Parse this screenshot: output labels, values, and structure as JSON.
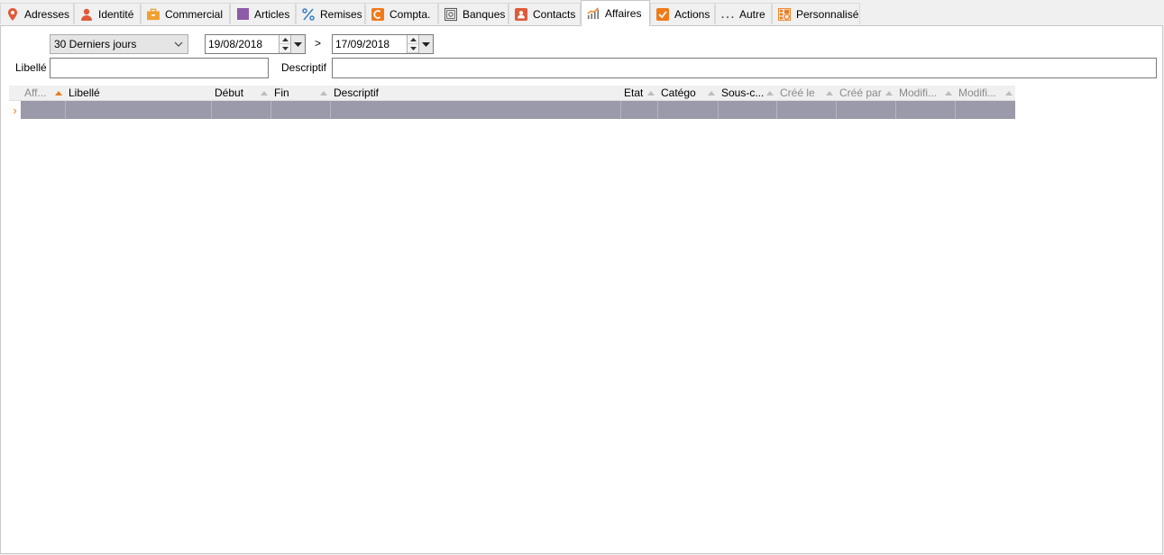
{
  "tabs": [
    {
      "label": "Adresses",
      "icon": "map-pin-icon",
      "color": "#e05a3a"
    },
    {
      "label": "Identité",
      "icon": "person-icon",
      "color": "#e05a3a"
    },
    {
      "label": "Commercial",
      "icon": "briefcase-icon",
      "color": "#f0a030"
    },
    {
      "label": "Articles",
      "icon": "square-icon",
      "color": "#8e5ba8"
    },
    {
      "label": "Remises",
      "icon": "percent-icon",
      "color": "#3a7fc4"
    },
    {
      "label": "Compta.",
      "icon": "accounting-icon",
      "color": "#f07a1a"
    },
    {
      "label": "Banques",
      "icon": "safe-icon",
      "color": "#555555"
    },
    {
      "label": "Contacts",
      "icon": "contact-card-icon",
      "color": "#e05a3a"
    },
    {
      "label": "Affaires",
      "icon": "chart-icon",
      "color": "#f07a1a",
      "active": true
    },
    {
      "label": "Actions",
      "icon": "checkbox-icon",
      "color": "#f07a1a"
    },
    {
      "label": "Autre",
      "icon": "more-dots-icon",
      "color": "#555555"
    },
    {
      "label": "Personnalisé",
      "icon": "custom-icon",
      "color": "#f07a1a"
    }
  ],
  "filter": {
    "period": "30 Derniers jours",
    "date_from": "19/08/2018",
    "date_sep": ">",
    "date_to": "17/09/2018",
    "libelle_label": "Libellé",
    "libelle_value": "",
    "descriptif_label": "Descriptif",
    "descriptif_value": ""
  },
  "grid": {
    "columns": [
      {
        "label": "Aff...",
        "dim": true,
        "sort": "asc-active"
      },
      {
        "label": "Libellé"
      },
      {
        "label": "Début",
        "sort": "asc"
      },
      {
        "label": "Fin",
        "sort": "asc"
      },
      {
        "label": "Descriptif"
      },
      {
        "label": "Etat",
        "sort": "asc"
      },
      {
        "label": "Catégo",
        "sort": "asc"
      },
      {
        "label": "Sous-c...",
        "sort": "asc"
      },
      {
        "label": "Créé le",
        "dim": true,
        "sort": "asc"
      },
      {
        "label": "Créé par",
        "dim": true,
        "sort": "asc"
      },
      {
        "label": "Modifi...",
        "dim": true,
        "sort": "asc"
      },
      {
        "label": "Modifi...",
        "dim": true,
        "sort": "asc"
      }
    ],
    "row_indicator": "›",
    "accent_color": "#f07a1a",
    "selected_row_color": "#9a9aaa"
  }
}
